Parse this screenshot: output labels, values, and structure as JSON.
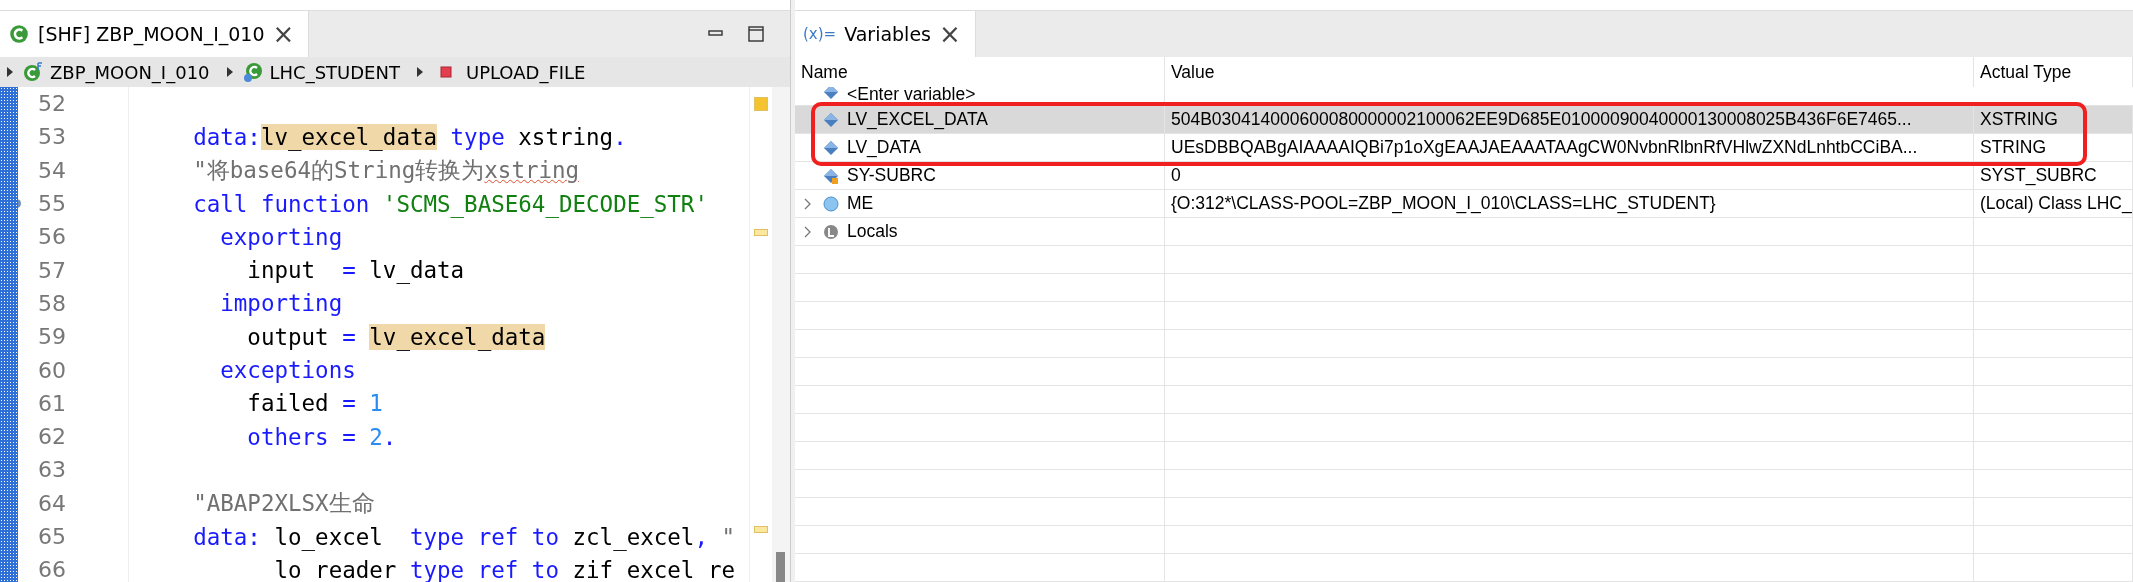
{
  "editor": {
    "tab": {
      "title": "[SHF] ZBP_MOON_I_010",
      "close": "×"
    },
    "breadcrumb": [
      {
        "label": "ZBP_MOON_I_010",
        "kind": "class-pool"
      },
      {
        "label": "LHC_STUDENT",
        "kind": "local-class"
      },
      {
        "label": "UPLOAD_FILE",
        "kind": "method"
      }
    ],
    "lines": [
      {
        "number": "52"
      },
      {
        "number": "53",
        "tokens": [
          {
            "t": "    data:",
            "kind": "keyword"
          },
          {
            "t": "lv_excel_data",
            "kind": "highlight"
          },
          {
            "t": " type ",
            "kind": "keyword"
          },
          {
            "t": "xstring",
            "kind": "plain"
          },
          {
            "t": ".",
            "kind": "keyword"
          }
        ]
      },
      {
        "number": "54",
        "tokens": [
          {
            "t": "    \"将base64的String转换为",
            "kind": "comment"
          },
          {
            "t": "xstring",
            "kind": "comment",
            "misspelled": true
          }
        ]
      },
      {
        "number": "55",
        "marker": true,
        "tokens": [
          {
            "t": "    call function ",
            "kind": "keyword"
          },
          {
            "t": "'SCMS_BASE64_DECODE_STR'",
            "kind": "string"
          }
        ]
      },
      {
        "number": "56",
        "tokens": [
          {
            "t": "      exporting",
            "kind": "keyword"
          }
        ]
      },
      {
        "number": "57",
        "tokens": [
          {
            "t": "        input  ",
            "kind": "plain"
          },
          {
            "t": "=",
            "kind": "keyword"
          },
          {
            "t": " lv_data",
            "kind": "plain"
          }
        ]
      },
      {
        "number": "58",
        "tokens": [
          {
            "t": "      importing",
            "kind": "keyword"
          }
        ]
      },
      {
        "number": "59",
        "tokens": [
          {
            "t": "        output ",
            "kind": "plain"
          },
          {
            "t": "= ",
            "kind": "keyword"
          },
          {
            "t": "lv_excel_data",
            "kind": "highlight"
          }
        ]
      },
      {
        "number": "60",
        "tokens": [
          {
            "t": "      exceptions",
            "kind": "keyword"
          }
        ]
      },
      {
        "number": "61",
        "tokens": [
          {
            "t": "        failed ",
            "kind": "plain"
          },
          {
            "t": "=",
            "kind": "keyword"
          },
          {
            "t": " 1",
            "kind": "number"
          }
        ]
      },
      {
        "number": "62",
        "tokens": [
          {
            "t": "        others = ",
            "kind": "keyword"
          },
          {
            "t": "2",
            "kind": "number"
          },
          {
            "t": ".",
            "kind": "keyword"
          }
        ]
      },
      {
        "number": "63"
      },
      {
        "number": "64",
        "tokens": [
          {
            "t": "    \"ABAP2XLSX生命",
            "kind": "comment"
          }
        ]
      },
      {
        "number": "65",
        "tokens": [
          {
            "t": "    data:",
            "kind": "keyword"
          },
          {
            "t": " lo_excel  ",
            "kind": "plain"
          },
          {
            "t": "type ref to",
            "kind": "keyword"
          },
          {
            "t": " zcl_excel",
            "kind": "plain"
          },
          {
            "t": ",",
            "kind": "keyword"
          },
          {
            "t": " \"",
            "kind": "comment"
          }
        ]
      },
      {
        "number": "66",
        "tokens": [
          {
            "t": "          lo_reader ",
            "kind": "plain"
          },
          {
            "t": "type ref to",
            "kind": "keyword"
          },
          {
            "t": " zif_excel_re",
            "kind": "plain"
          }
        ]
      }
    ]
  },
  "variables": {
    "tab": {
      "icon": "(x)=",
      "title": "Variables",
      "close": "×"
    },
    "columns": [
      "Name",
      "Value",
      "Actual Type"
    ],
    "rows": [
      {
        "name": "<Enter variable>",
        "kind": "variable",
        "selected": false,
        "expandable": false,
        "outlined": false
      },
      {
        "name": "LV_EXCEL_DATA",
        "value": "504B030414000600080000002100062EE9D685E01000090040000130008025B436F6E7465...",
        "type": "XSTRING",
        "kind": "variable",
        "selected": true,
        "expandable": false,
        "outlined": true
      },
      {
        "name": "LV_DATA",
        "value": "UEsDBBQABgAIAAAAIQBi7p1oXgEAAJAEAAATAAgCW0NvbnRlbnRfVHlwZXNdLnhtbCCiBA...",
        "type": "STRING",
        "kind": "variable",
        "selected": false,
        "expandable": false,
        "outlined": true
      },
      {
        "name": "SY-SUBRC",
        "value": "0",
        "type": "SYST_SUBRC",
        "kind": "system",
        "selected": false,
        "expandable": false,
        "outlined": false
      },
      {
        "name": "ME",
        "value": "{O:312*\\CLASS-POOL=ZBP_MOON_I_010\\CLASS=LHC_STUDENT}",
        "type": "(Local) Class LHC_",
        "kind": "object",
        "selected": false,
        "expandable": true,
        "outlined": false
      },
      {
        "name": "Locals",
        "kind": "locals",
        "selected": false,
        "expandable": true,
        "outlined": false
      }
    ]
  }
}
